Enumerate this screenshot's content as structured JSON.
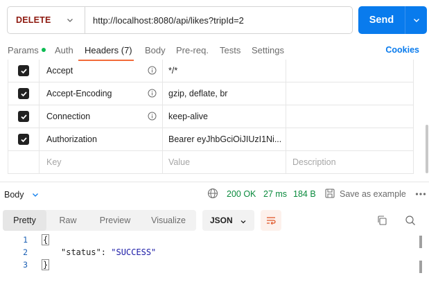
{
  "request": {
    "method": "DELETE",
    "url": "http://localhost:8080/api/likes?tripId=2",
    "send_label": "Send"
  },
  "tabs": [
    {
      "label": "Params"
    },
    {
      "label": "Auth"
    },
    {
      "label": "Headers (7)"
    },
    {
      "label": "Body"
    },
    {
      "label": "Pre-req."
    },
    {
      "label": "Tests"
    },
    {
      "label": "Settings"
    }
  ],
  "cookies_label": "Cookies",
  "headers": [
    {
      "key": "Accept",
      "value": "*/*",
      "checked": true
    },
    {
      "key": "Accept-Encoding",
      "value": "gzip, deflate, br",
      "checked": true
    },
    {
      "key": "Connection",
      "value": "keep-alive",
      "checked": true
    },
    {
      "key": "Authorization",
      "value": "Bearer eyJhbGciOiJIUzI1Ni...",
      "checked": true
    }
  ],
  "placeholders": {
    "key": "Key",
    "value": "Value",
    "description": "Description"
  },
  "response": {
    "body_label": "Body",
    "status": "200 OK",
    "time": "27 ms",
    "size": "184 B",
    "save_label": "Save as example"
  },
  "view_tabs": [
    {
      "label": "Pretty"
    },
    {
      "label": "Raw"
    },
    {
      "label": "Preview"
    },
    {
      "label": "Visualize"
    }
  ],
  "format_label": "JSON",
  "code": {
    "line_numbers": [
      "1",
      "2",
      "3"
    ],
    "open_brace": "{",
    "key": "\"status\"",
    "colon": ": ",
    "value": "\"SUCCESS\"",
    "close_brace": "}"
  },
  "colors": {
    "method": "#8e1a10",
    "send": "#097bed",
    "accent": "#f26b3a",
    "status_ok": "#0a8a3d"
  }
}
